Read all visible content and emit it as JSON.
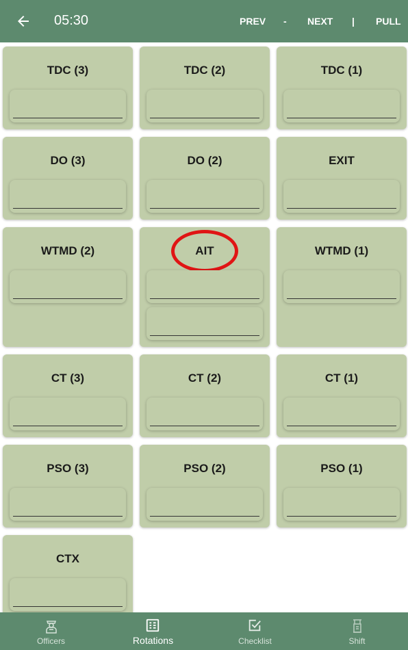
{
  "header": {
    "time": "05:30",
    "prev_label": "PREV",
    "dash": "-",
    "next_label": "NEXT",
    "separator": "|",
    "pull_label": "PULL"
  },
  "cards": [
    {
      "title": "TDC (3)",
      "slots": 1
    },
    {
      "title": "TDC (2)",
      "slots": 1
    },
    {
      "title": "TDC (1)",
      "slots": 1
    },
    {
      "title": "DO (3)",
      "slots": 1
    },
    {
      "title": "DO (2)",
      "slots": 1
    },
    {
      "title": "EXIT",
      "slots": 1
    },
    {
      "title": "WTMD (2)",
      "slots": 1
    },
    {
      "title": "AIT",
      "slots": 2
    },
    {
      "title": "WTMD (1)",
      "slots": 1
    },
    {
      "title": "CT (3)",
      "slots": 1
    },
    {
      "title": "CT (2)",
      "slots": 1
    },
    {
      "title": "CT (1)",
      "slots": 1
    },
    {
      "title": "PSO (3)",
      "slots": 1
    },
    {
      "title": "PSO (2)",
      "slots": 1
    },
    {
      "title": "PSO (1)",
      "slots": 1
    },
    {
      "title": "CTX",
      "slots": 1
    }
  ],
  "tabs": [
    {
      "label": "Officers",
      "icon": "officer-icon"
    },
    {
      "label": "Rotations",
      "icon": "rotations-icon",
      "active": true
    },
    {
      "label": "Checklist",
      "icon": "checklist-icon"
    },
    {
      "label": "Shift",
      "icon": "shift-icon"
    }
  ],
  "colors": {
    "bar": "#5d8a6e",
    "card": "#c0cda9",
    "annotation": "#e01515"
  }
}
